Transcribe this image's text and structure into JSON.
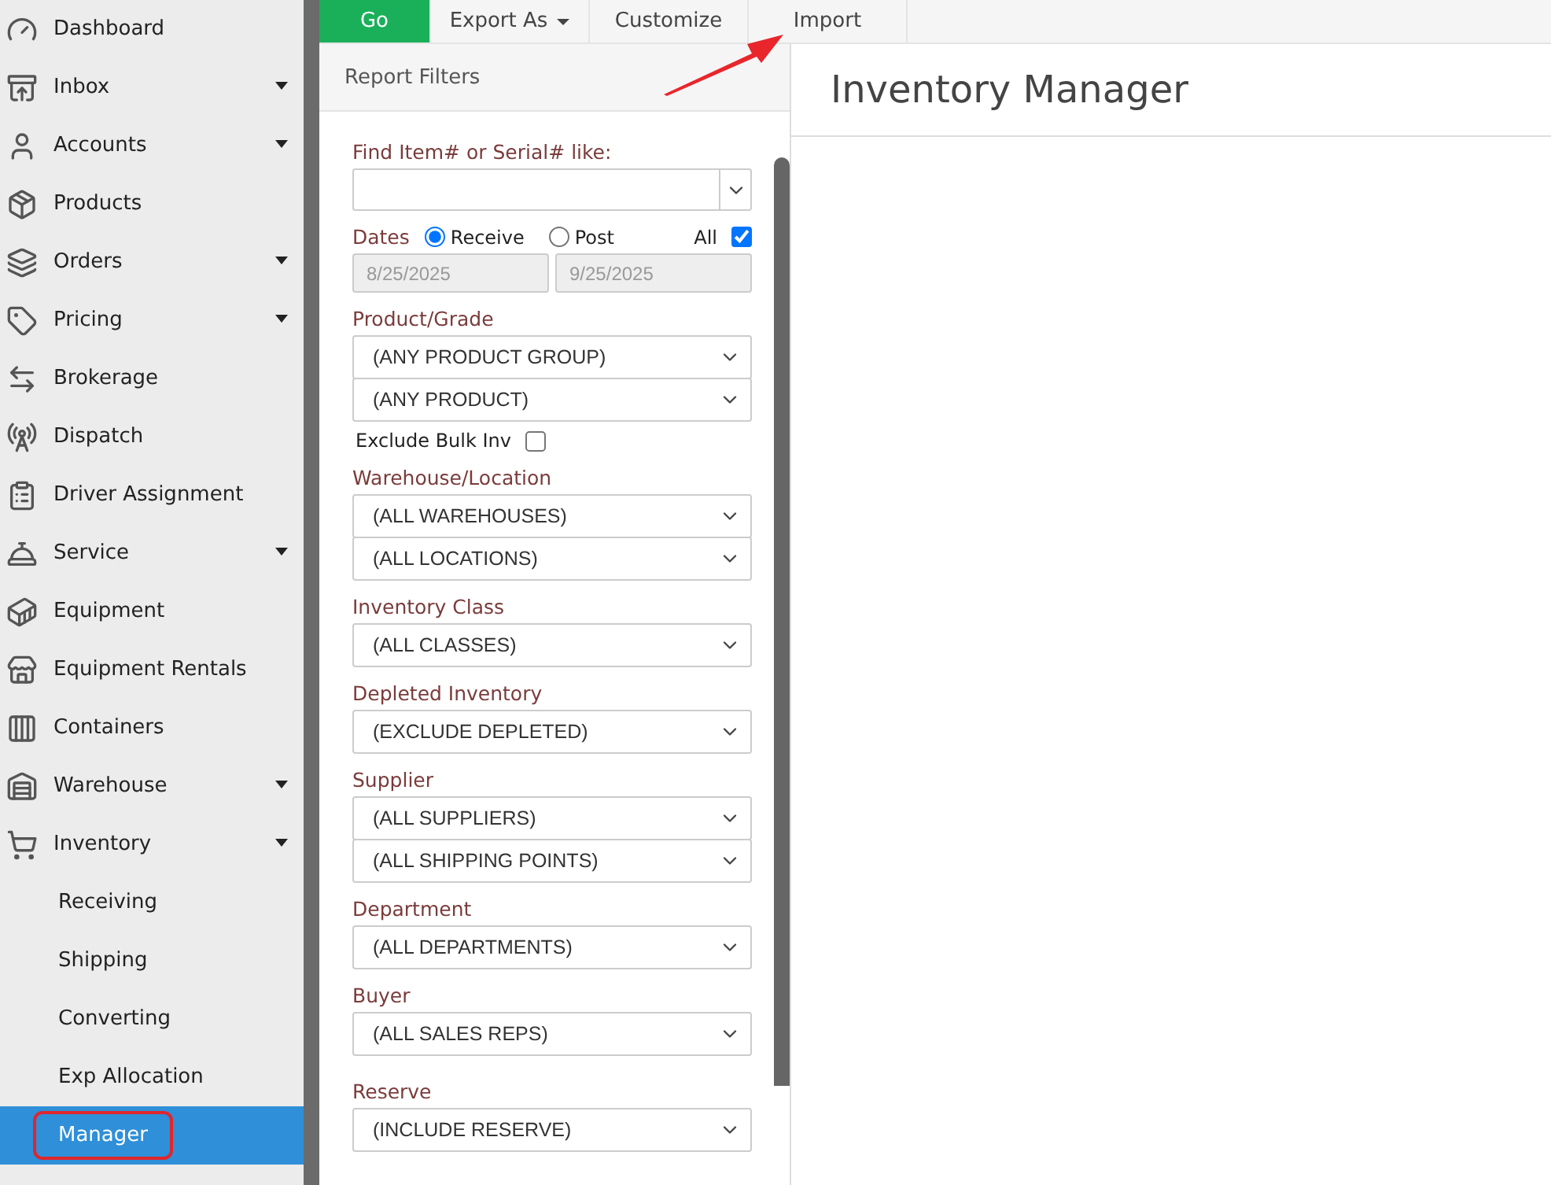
{
  "sidebar": {
    "items": [
      {
        "kind": "menu",
        "label": "Dashboard",
        "caret": false,
        "selected": false
      },
      {
        "kind": "menu",
        "label": "Inbox",
        "caret": true,
        "selected": false
      },
      {
        "kind": "menu",
        "label": "Accounts",
        "caret": true,
        "selected": false
      },
      {
        "kind": "menu",
        "label": "Products",
        "caret": false,
        "selected": false
      },
      {
        "kind": "menu",
        "label": "Orders",
        "caret": true,
        "selected": false
      },
      {
        "kind": "menu",
        "label": "Pricing",
        "caret": true,
        "selected": false
      },
      {
        "kind": "menu",
        "label": "Brokerage",
        "caret": false,
        "selected": false
      },
      {
        "kind": "menu",
        "label": "Dispatch",
        "caret": false,
        "selected": false
      },
      {
        "kind": "menu",
        "label": "Driver Assignment",
        "caret": false,
        "selected": false
      },
      {
        "kind": "menu",
        "label": "Service",
        "caret": true,
        "selected": false
      },
      {
        "kind": "menu",
        "label": "Equipment",
        "caret": false,
        "selected": false
      },
      {
        "kind": "menu",
        "label": "Equipment Rentals",
        "caret": false,
        "selected": false
      },
      {
        "kind": "menu",
        "label": "Containers",
        "caret": false,
        "selected": false
      },
      {
        "kind": "menu",
        "label": "Warehouse",
        "caret": true,
        "selected": false
      },
      {
        "kind": "menu",
        "label": "Inventory",
        "caret": true,
        "selected": false
      },
      {
        "kind": "submenu",
        "label": "Receiving",
        "caret": false,
        "selected": false
      },
      {
        "kind": "submenu",
        "label": "Shipping",
        "caret": false,
        "selected": false
      },
      {
        "kind": "submenu",
        "label": "Converting",
        "caret": false,
        "selected": false
      },
      {
        "kind": "submenu",
        "label": "Exp Allocation",
        "caret": false,
        "selected": false
      },
      {
        "kind": "submenu",
        "label": "Manager",
        "caret": false,
        "selected": true
      }
    ]
  },
  "toolbar": [
    {
      "kind": "primary",
      "label": "Go",
      "caret": false
    },
    {
      "kind": "plain",
      "label": "Export As",
      "caret": true
    },
    {
      "kind": "plain",
      "label": "Customize",
      "caret": false
    },
    {
      "kind": "plain",
      "label": "Import",
      "caret": false
    }
  ],
  "filters": {
    "title": "Report Filters",
    "sections": [
      {
        "kind": "combo",
        "label": "Find Item# or Serial# like:"
      },
      {
        "kind": "dates",
        "label": "Dates",
        "options": [
          {
            "label": "Receive",
            "selected": true
          },
          {
            "label": "Post",
            "selected": false
          }
        ],
        "all": {
          "label": "All",
          "checked": true
        },
        "from": "8/25/2025",
        "to": "9/25/2025",
        "disabled": true
      },
      {
        "kind": "selects",
        "label": "Product/Grade",
        "values": [
          "(ANY PRODUCT GROUP)",
          "(ANY PRODUCT)"
        ]
      },
      {
        "kind": "checkbox",
        "label": "Exclude Bulk Inv",
        "checked": false
      },
      {
        "kind": "selects",
        "label": "Warehouse/Location",
        "values": [
          "(ALL WAREHOUSES)",
          "(ALL LOCATIONS)"
        ]
      },
      {
        "kind": "selects",
        "label": "Inventory Class",
        "values": [
          "(ALL CLASSES)"
        ]
      },
      {
        "kind": "selects",
        "label": "Depleted Inventory",
        "values": [
          "(EXCLUDE DEPLETED)"
        ]
      },
      {
        "kind": "selects",
        "label": "Supplier",
        "values": [
          "(ALL SUPPLIERS)",
          "(ALL SHIPPING POINTS)"
        ]
      },
      {
        "kind": "selects",
        "label": "Department",
        "values": [
          "(ALL DEPARTMENTS)"
        ]
      },
      {
        "kind": "selects",
        "label": "Buyer",
        "values": [
          "(ALL SALES REPS)"
        ]
      },
      {
        "kind": "selects",
        "label": "Reserve",
        "values": [
          "(INCLUDE RESERVE)"
        ]
      }
    ]
  },
  "main": {
    "title": "Inventory Manager"
  }
}
